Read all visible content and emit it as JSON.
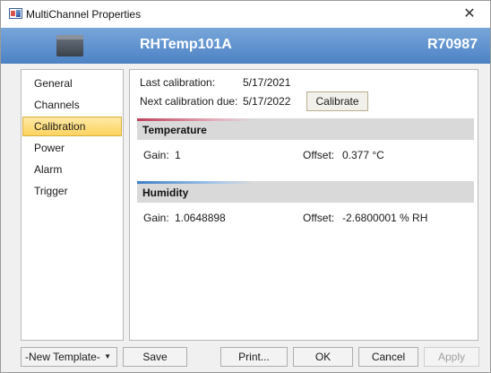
{
  "window": {
    "title": "MultiChannel Properties"
  },
  "header": {
    "device_name": "RHTemp101A",
    "serial": "R70987"
  },
  "sidebar": {
    "items": [
      {
        "label": "General"
      },
      {
        "label": "Channels"
      },
      {
        "label": "Calibration",
        "selected": true
      },
      {
        "label": "Power"
      },
      {
        "label": "Alarm"
      },
      {
        "label": "Trigger"
      }
    ]
  },
  "calibration": {
    "last_label": "Last calibration:",
    "last_value": "5/17/2021",
    "next_label": "Next calibration due:",
    "next_value": "5/17/2022",
    "calibrate_button": "Calibrate"
  },
  "temperature": {
    "title": "Temperature",
    "gain_label": "Gain:",
    "gain_value": "1",
    "offset_label": "Offset:",
    "offset_value": "0.377 °C",
    "accent_color": "#c0405a"
  },
  "humidity": {
    "title": "Humidity",
    "gain_label": "Gain:",
    "gain_value": "1.0648898",
    "offset_label": "Offset:",
    "offset_value": "-2.6800001 % RH",
    "accent_color": "#3f7fc8"
  },
  "footer": {
    "template_select": "-New Template-",
    "save": "Save",
    "print": "Print...",
    "ok": "OK",
    "cancel": "Cancel",
    "apply": "Apply"
  },
  "icons": {
    "close": "close-icon",
    "dropdown": "chevron-down-icon",
    "app": "app-icon",
    "device": "device-icon"
  }
}
